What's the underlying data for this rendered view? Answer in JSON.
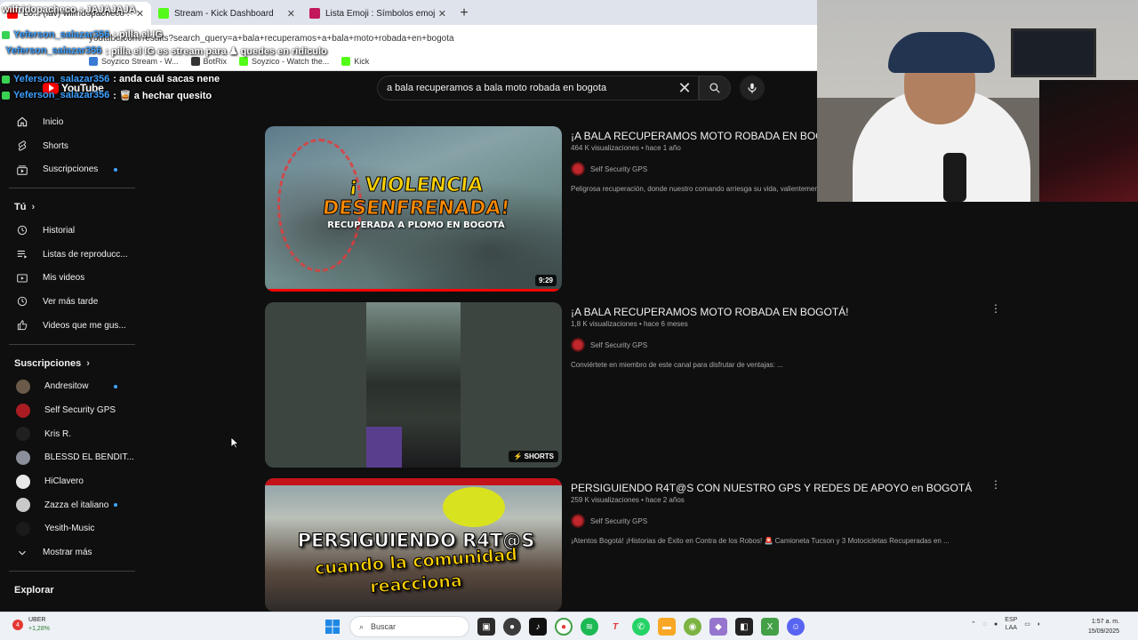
{
  "browser": {
    "tabs": [
      {
        "label": "Lo... (fav) wilfridopacheco : JAJAJAJA",
        "active": true
      },
      {
        "label": "Stream - Kick Dashboard",
        "active": false
      },
      {
        "label": "Lista Emoji : Símbolos emoji na",
        "active": false
      }
    ],
    "url": "youtube.com/results?search_query=a+bala+recuperamos+a+bala+moto+robada+en+bogota",
    "bookmarks": [
      "Soyzico Stream - W...",
      "BotRix",
      "Soyzico - Watch the...",
      "Kick"
    ]
  },
  "chat": [
    {
      "user": "wilfridopacheco",
      "message": ": JAJAJAJA"
    },
    {
      "user": "Yeferson_salazar356",
      "message": ": pilla el IG"
    },
    {
      "user": "Yeferson_salazar356",
      "message": ": pilla el IG es stream para ♟ quedes en ridiculo"
    },
    {
      "user": "Yeferson_salazar356",
      "message": ": anda cuál sacas nene"
    },
    {
      "user": "Yeferson_salazar356",
      "message": ": 🥃 a hechar quesito"
    }
  ],
  "youtube": {
    "logo": "YouTube",
    "search_query": "a bala recuperamos a bala moto robada en bogota"
  },
  "sidebar": {
    "main": [
      {
        "label": "Inicio",
        "icon": "home-icon"
      },
      {
        "label": "Shorts",
        "icon": "shorts-icon"
      },
      {
        "label": "Suscripciones",
        "icon": "subscriptions-icon",
        "dot": true
      }
    ],
    "you_heading": "Tú",
    "you": [
      {
        "label": "Historial",
        "icon": "history-icon"
      },
      {
        "label": "Listas de reproducc...",
        "icon": "playlists-icon"
      },
      {
        "label": "Mis videos",
        "icon": "my-videos-icon"
      },
      {
        "label": "Ver más tarde",
        "icon": "watch-later-icon"
      },
      {
        "label": "Videos que me gus...",
        "icon": "like-icon"
      }
    ],
    "subs_heading": "Suscripciones",
    "subs": [
      {
        "label": "Andresitow",
        "color": "#6b5a4a",
        "dot": true
      },
      {
        "label": "Self Security GPS",
        "color": "#a81c22",
        "dot": false
      },
      {
        "label": "Kris R.",
        "color": "#202020",
        "dot": false
      },
      {
        "label": "BLESSD EL BENDIT...",
        "color": "#8a8f99",
        "dot": false
      },
      {
        "label": "HiClavero",
        "color": "#e8e8e8",
        "dot": false
      },
      {
        "label": "Zazza el italiano",
        "color": "#c9c9c9",
        "dot": true
      },
      {
        "label": "Yesith-Music",
        "color": "#1a1a1a",
        "dot": false
      }
    ],
    "show_more": "Mostrar más",
    "explore_heading": "Explorar"
  },
  "results": [
    {
      "title": "¡A BALA RECUPERAMOS MOTO ROBADA EN BOGOTÁ!",
      "meta": "464 K visualizaciones • hace 1 año",
      "channel": "Self Security GPS",
      "description": "Peligrosa recuperación, donde nuestro comando arriesga su vida, valientemente.",
      "duration": "9:29",
      "watched": 1.0,
      "thumb_lines": [
        "¡ VIOLENCIA",
        "DESENFRENADA!",
        "RECUPERADA A PLOMO EN BOGOTÁ"
      ]
    },
    {
      "title": "¡A BALA RECUPERAMOS MOTO ROBADA EN BOGOTÁ!",
      "meta": "1,8 K visualizaciones • hace 6 meses",
      "channel": "Self Security GPS",
      "description": "Conviértete en miembro de este canal para disfrutar de ventajas: ...",
      "badge": "SHORTS"
    },
    {
      "title": "PERSIGUIENDO R4T@S CON NUESTRO GPS Y REDES DE APOYO en BOGOTÁ",
      "meta": "259 K visualizaciones • hace 2 años",
      "channel": "Self Security GPS",
      "description": "¡Atentos Bogotá! ¡Historias de Éxito en Contra de los Robos! 🚨 Camioneta Tucson y 3 Motocicletas Recuperadas en ...",
      "thumb_lines": [
        "PERSIGUIENDO R4T@S",
        "cuando la comunidad",
        "reacciona"
      ]
    }
  ],
  "taskbar": {
    "stock_name": "UBER",
    "stock_change": "+1,28%",
    "stock_badge": "4",
    "search_label": "Buscar",
    "lang_top": "ESP",
    "lang_bottom": "LAA",
    "time": "1:57 a. m.",
    "date": "15/09/2025"
  },
  "colors": {
    "background": "#0f0f0f",
    "accent_red": "#ff0000",
    "link_blue": "#3ea6ff"
  }
}
